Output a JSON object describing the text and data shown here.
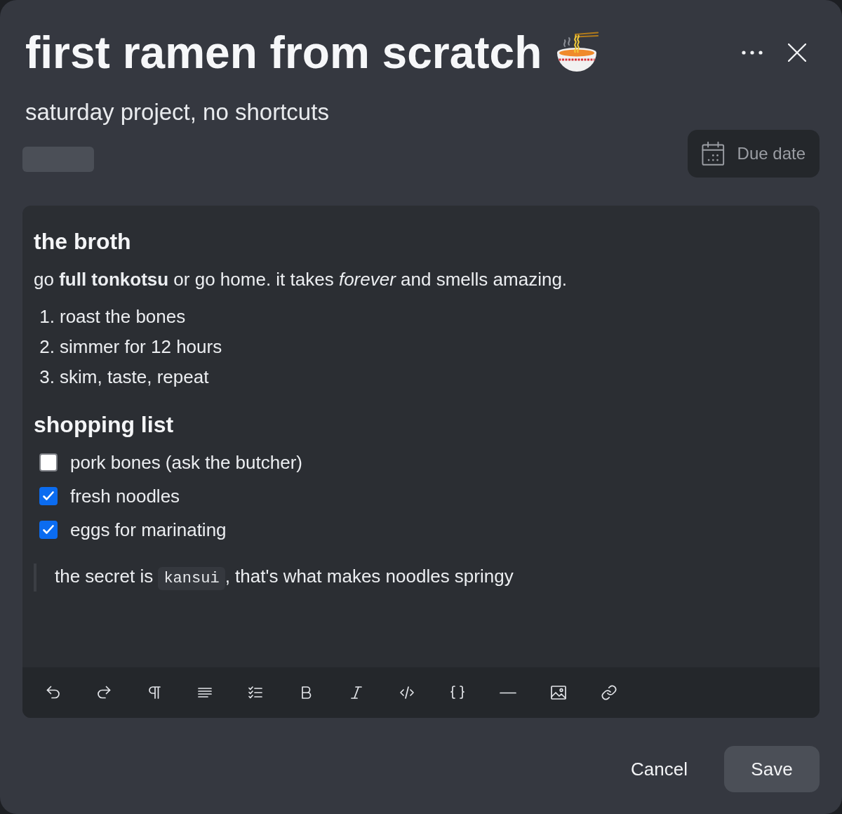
{
  "dialog": {
    "title": "first ramen from scratch",
    "subtitle": "saturday project, no shortcuts",
    "due_date_button": "Due date"
  },
  "editor": {
    "blocks": [
      {
        "kind": "heading",
        "text": "the broth"
      },
      {
        "kind": "paragraph",
        "text": "go **full tonkotsu** or go home. it takes *forever* and smells amazing."
      },
      {
        "kind": "ordered_list",
        "items": [
          {
            "number": "1.",
            "text": "roast the bones"
          },
          {
            "number": "2.",
            "text": "simmer for 12 hours"
          },
          {
            "number": "3.",
            "text": "skim, taste, repeat"
          }
        ]
      },
      {
        "kind": "heading",
        "text": "shopping list"
      },
      {
        "kind": "task_list",
        "items": [
          {
            "text": "pork bones (ask the butcher)",
            "checked": false
          },
          {
            "text": "fresh noodles",
            "checked": true
          },
          {
            "text": "eggs for marinating",
            "checked": true
          }
        ]
      },
      {
        "kind": "blockquote",
        "before": "the secret is",
        "code": "kansui",
        "after": ", that's what makes noodles springy"
      }
    ]
  },
  "footer": {
    "buttons": [
      {
        "kind": "text",
        "label": "Cancel"
      },
      {
        "kind": "filled",
        "label": "Save"
      }
    ]
  }
}
